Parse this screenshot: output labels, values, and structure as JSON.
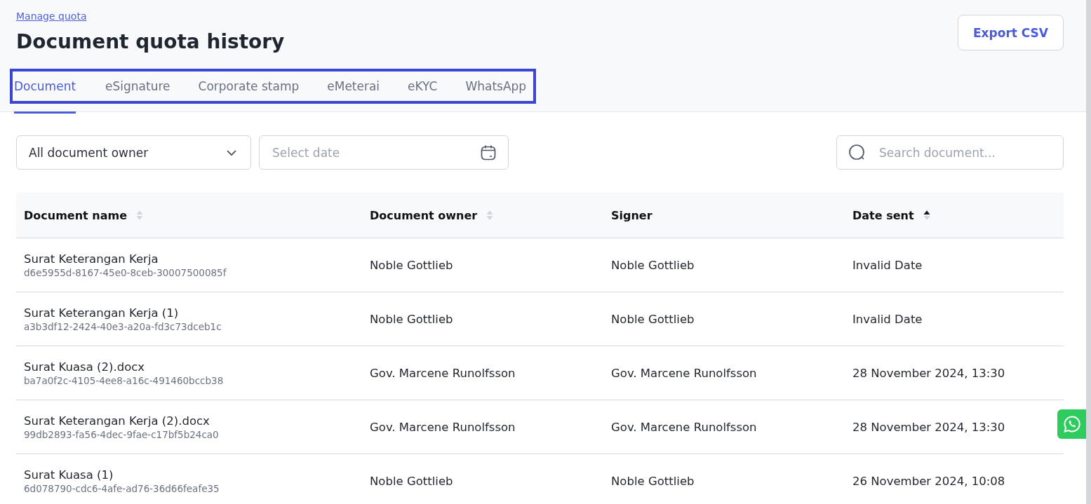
{
  "breadcrumb": "Manage quota",
  "title": "Document quota history",
  "export_button": "Export CSV",
  "tabs": [
    {
      "label": "Document",
      "selected": true
    },
    {
      "label": "eSignature",
      "selected": false
    },
    {
      "label": "Corporate stamp",
      "selected": false
    },
    {
      "label": "eMeterai",
      "selected": false
    },
    {
      "label": "eKYC",
      "selected": false
    },
    {
      "label": "WhatsApp",
      "selected": false
    }
  ],
  "filters": {
    "owner_dropdown": "All document owner",
    "date_field": {
      "placeholder": "Select date"
    },
    "search_field": {
      "placeholder": "Search document..."
    }
  },
  "table": {
    "columns": [
      {
        "label": "Document name",
        "sortable": true,
        "sorted_ascending": false
      },
      {
        "label": "Document owner",
        "sortable": true,
        "sorted_ascending": false
      },
      {
        "label": "Signer",
        "sortable": false
      },
      {
        "label": "Date sent",
        "sortable": true,
        "sorted_ascending": true
      }
    ],
    "rows": [
      {
        "name": "Surat Keterangan Kerja",
        "id": "d6e5955d-8167-45e0-8ceb-30007500085f",
        "owner": "Noble Gottlieb",
        "signer": "Noble Gottlieb",
        "date": "Invalid Date"
      },
      {
        "name": "Surat Keterangan Kerja (1)",
        "id": "a3b3df12-2424-40e3-a20a-fd3c73dceb1c",
        "owner": "Noble Gottlieb",
        "signer": "Noble Gottlieb",
        "date": "Invalid Date"
      },
      {
        "name": "Surat Kuasa (2).docx",
        "id": "ba7a0f2c-4105-4ee8-a16c-491460bccb38",
        "owner": "Gov. Marcene Runolfsson",
        "signer": "Gov. Marcene Runolfsson",
        "date": "28 November 2024, 13:30"
      },
      {
        "name": "Surat Keterangan Kerja (2).docx",
        "id": "99db2893-fa56-4dec-9fae-c17bf5b24ca0",
        "owner": "Gov. Marcene Runolfsson",
        "signer": "Gov. Marcene Runolfsson",
        "date": "28 November 2024, 13:30"
      },
      {
        "name": "Surat Kuasa (1)",
        "id": "6d078790-cdc6-4afe-ad76-36d66feafe35",
        "owner": "Noble Gottlieb",
        "signer": "Noble Gottlieb",
        "date": "26 November 2024, 10:08"
      }
    ]
  }
}
